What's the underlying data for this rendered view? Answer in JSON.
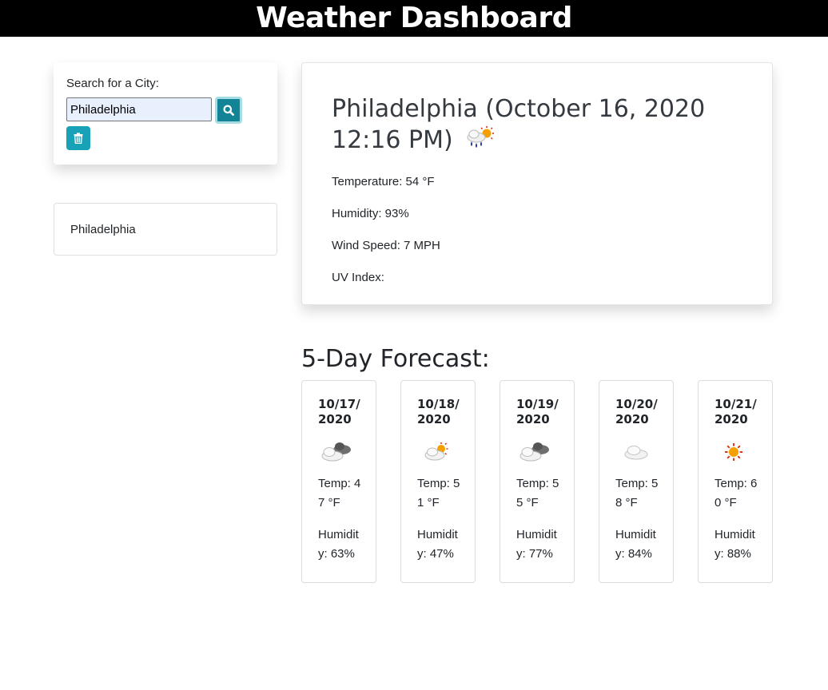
{
  "header": {
    "title": "Weather Dashboard"
  },
  "search": {
    "label": "Search for a City:",
    "value": "Philadelphia",
    "search_icon": "search-icon",
    "clear_icon": "trash-icon"
  },
  "history": {
    "items": [
      {
        "label": "Philadelphia"
      }
    ]
  },
  "current": {
    "title": "Philadelphia (October 16, 2020 12:16 PM)",
    "icon": "rain-sun-icon",
    "temperature": "Temperature: 54 °F",
    "humidity": "Humidity: 93%",
    "wind": "Wind Speed: 7 MPH",
    "uv": "UV Index:"
  },
  "forecast": {
    "heading": "5-Day Forecast:",
    "days": [
      {
        "date": "10/17/2020",
        "icon": "broken-clouds-icon",
        "temp": "Temp: 47 °F",
        "humidity": "Humidity: 63%"
      },
      {
        "date": "10/18/2020",
        "icon": "few-clouds-sun-icon",
        "temp": "Temp: 51 °F",
        "humidity": "Humidity: 47%"
      },
      {
        "date": "10/19/2020",
        "icon": "broken-clouds-icon",
        "temp": "Temp: 55 °F",
        "humidity": "Humidity: 77%"
      },
      {
        "date": "10/20/2020",
        "icon": "cloud-icon",
        "temp": "Temp: 58 °F",
        "humidity": "Humidity: 84%"
      },
      {
        "date": "10/21/2020",
        "icon": "sun-icon",
        "temp": "Temp: 60 °F",
        "humidity": "Humidity: 88%"
      }
    ]
  },
  "colors": {
    "header_bg": "#000000",
    "button_primary": "#17a2b8",
    "button_active": "#138496"
  }
}
